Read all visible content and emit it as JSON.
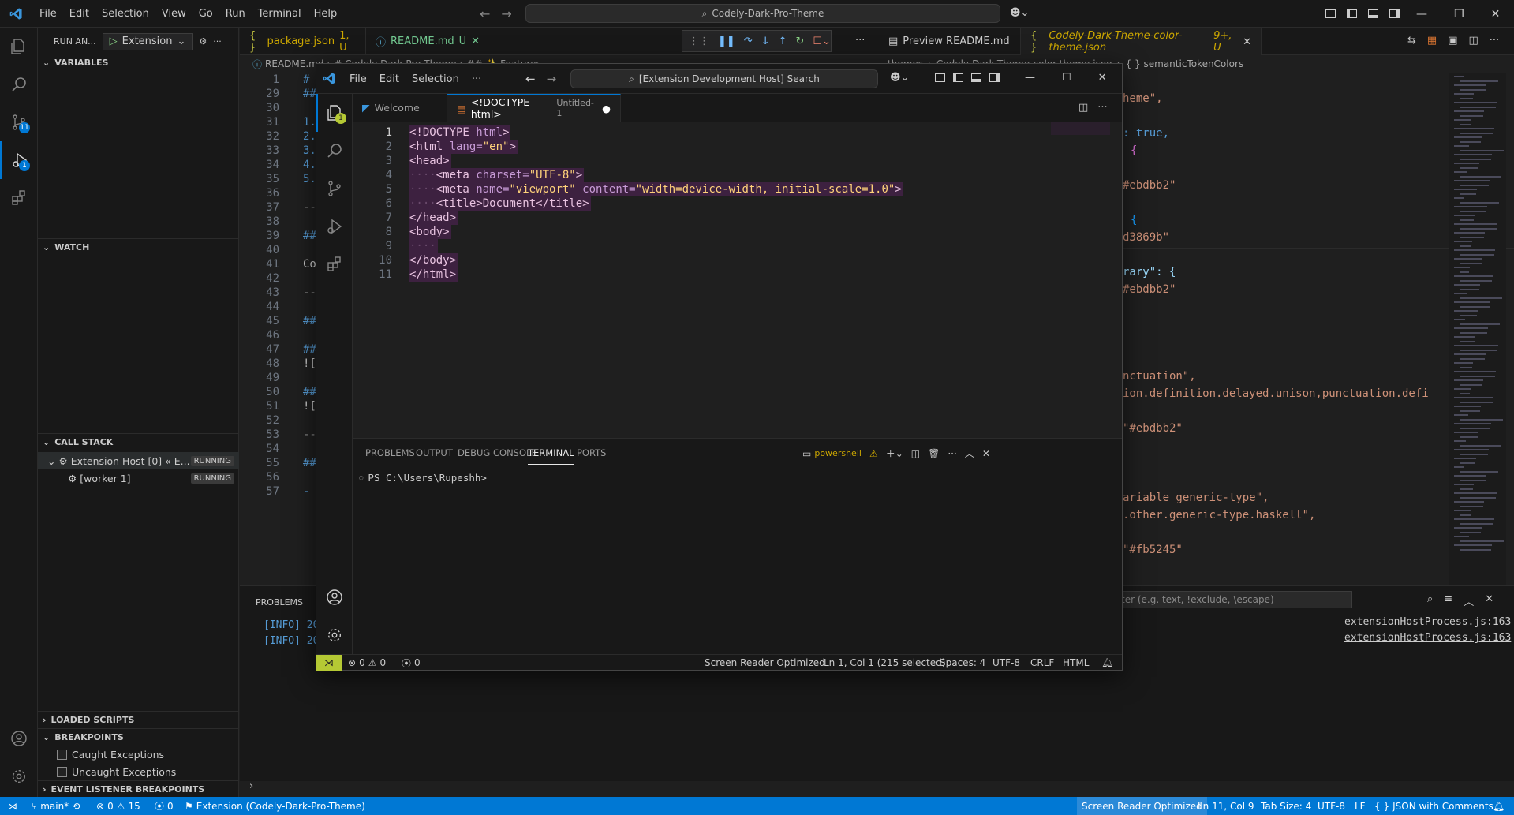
{
  "outer": {
    "menu": [
      "File",
      "Edit",
      "Selection",
      "View",
      "Go",
      "Run",
      "Terminal",
      "Help"
    ],
    "search": "Codely-Dark-Pro-Theme",
    "sidebar": {
      "run_label": "RUN AN...",
      "config": "Extension",
      "sections": {
        "variables": "VARIABLES",
        "watch": "WATCH",
        "call_stack": "CALL STACK",
        "loaded_scripts": "LOADED SCRIPTS",
        "breakpoints": "BREAKPOINTS",
        "event_listener": "EVENT LISTENER BREAKPOINTS"
      },
      "call_stack": [
        {
          "label": "Extension Host [0] « E...",
          "status": "RUNNING"
        },
        {
          "label": "[worker 1]",
          "status": "RUNNING"
        }
      ],
      "breakpoints": [
        "Caught Exceptions",
        "Uncaught Exceptions"
      ]
    },
    "tabs": [
      {
        "label": "package.json",
        "suffix": "1, U"
      },
      {
        "label": "README.md",
        "suffix": "U"
      },
      {
        "label": "Preview README.md",
        "suffix": ""
      },
      {
        "label": "Codely-Dark-Theme-color-theme.json",
        "suffix": "9+, U"
      }
    ],
    "breadcrumb": [
      "README.md",
      "# Codely Dark Pro Theme",
      "## ✨ Features"
    ],
    "json_breadcrumb": [
      "themes",
      "Codely-Dark-Theme-color-theme.json",
      "{ } semanticTokenColors"
    ],
    "readme_lines": [
      {
        "n": "1",
        "t": "#"
      },
      {
        "n": "29",
        "t": "##"
      },
      {
        "n": "30",
        "t": ""
      },
      {
        "n": "31",
        "t": "1."
      },
      {
        "n": "32",
        "t": "2."
      },
      {
        "n": "33",
        "t": "3."
      },
      {
        "n": "34",
        "t": "4."
      },
      {
        "n": "35",
        "t": "5."
      },
      {
        "n": "36",
        "t": ""
      },
      {
        "n": "37",
        "t": "---"
      },
      {
        "n": "38",
        "t": ""
      },
      {
        "n": "39",
        "t": "##"
      },
      {
        "n": "40",
        "t": ""
      },
      {
        "n": "41",
        "t": "Coc"
      },
      {
        "n": "42",
        "t": ""
      },
      {
        "n": "43",
        "t": "---"
      },
      {
        "n": "44",
        "t": ""
      },
      {
        "n": "45",
        "t": "##"
      },
      {
        "n": "46",
        "t": ""
      },
      {
        "n": "47",
        "t": "###"
      },
      {
        "n": "48",
        "t": "![S"
      },
      {
        "n": "49",
        "t": ""
      },
      {
        "n": "50",
        "t": "###"
      },
      {
        "n": "51",
        "t": "![U"
      },
      {
        "n": "52",
        "t": ""
      },
      {
        "n": "53",
        "t": "---"
      },
      {
        "n": "54",
        "t": ""
      },
      {
        "n": "55",
        "t": "##"
      },
      {
        "n": "56",
        "t": ""
      },
      {
        "n": "57",
        "t": "- *"
      }
    ],
    "json_lines": [
      "heme\",",
      ": true,",
      "{",
      "#ebdbb2\"",
      "{",
      "d3869b\"",
      "rary\": {",
      "#ebdbb2\"",
      "nctuation\",",
      "ion.definition.delayed.unison,punctuation.defi",
      "\"#ebdbb2\"",
      "ariable generic-type\",",
      ".other.generic-type.haskell\",",
      "\"#fb5245\""
    ],
    "panel": {
      "tab": "PROBLEMS",
      "filter_placeholder": "ter (e.g. text, !exclude, \\escape)",
      "logs": [
        "[INFO] 20",
        "[INFO] 20"
      ],
      "links": [
        "extensionHostProcess.js:163",
        "extensionHostProcess.js:163"
      ]
    },
    "status": {
      "branch": "main*",
      "errors": "0",
      "warnings": "15",
      "ports": "0",
      "launch": "Extension (Codely-Dark-Pro-Theme)",
      "screen_reader": "Screen Reader Optimized",
      "position": "Ln 11, Col 9",
      "tab_size": "Tab Size: 4",
      "encoding": "UTF-8",
      "eol": "LF",
      "language": "JSON with Comments"
    }
  },
  "ext": {
    "menu": [
      "File",
      "Edit",
      "Selection"
    ],
    "search": "[Extension Development Host] Search",
    "tabs": [
      {
        "label": "Welcome"
      },
      {
        "label": "<!DOCTYPE html>",
        "suffix": "Untitled-1"
      }
    ],
    "panel_tabs": [
      "PROBLEMS",
      "OUTPUT",
      "DEBUG CONSOLE",
      "TERMINAL",
      "PORTS"
    ],
    "shell": "powershell",
    "prompt": "PS C:\\Users\\Rupeshh>",
    "status": {
      "errors": "0",
      "warnings": "0",
      "ports": "0",
      "screen_reader": "Screen Reader Optimized",
      "position": "Ln 1, Col 1 (215 selected)",
      "spaces": "Spaces: 4",
      "encoding": "UTF-8",
      "eol": "CRLF",
      "language": "HTML"
    }
  },
  "icons": {
    "explorer": "files-icon",
    "search": "search-icon",
    "scm": "source-control-icon",
    "debug": "run-debug-icon",
    "extensions": "extensions-icon",
    "account": "account-icon",
    "settings": "gear-icon"
  },
  "colors": {
    "accent": "#0078d4",
    "selection": "#3d2140",
    "ext_status_debug": "#b5c934"
  }
}
